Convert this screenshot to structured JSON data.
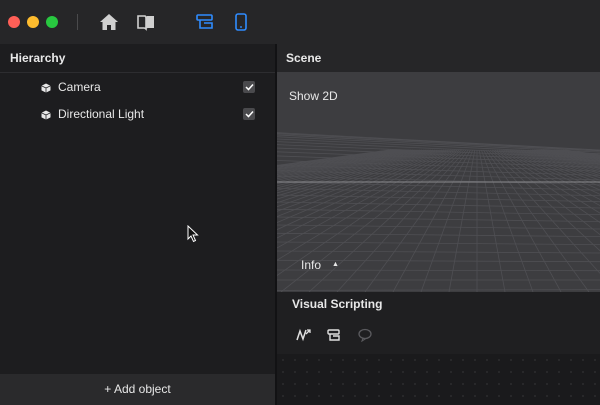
{
  "toolbar": {
    "icons": [
      "home-icon",
      "book-icon",
      "layout-icon",
      "device-icon"
    ],
    "accent_color": "#2f8cff"
  },
  "hierarchy": {
    "title": "Hierarchy",
    "items": [
      {
        "label": "Camera",
        "icon": "cube-icon",
        "visible": true
      },
      {
        "label": "Directional Light",
        "icon": "cube-icon",
        "visible": true
      }
    ],
    "add_label": "+ Add object"
  },
  "scene": {
    "title": "Scene",
    "show2d_label": "Show 2D",
    "info_label": "Info"
  },
  "visual_scripting": {
    "title": "Visual Scripting",
    "tools": [
      "curve-icon",
      "node-icon",
      "comment-icon"
    ]
  }
}
